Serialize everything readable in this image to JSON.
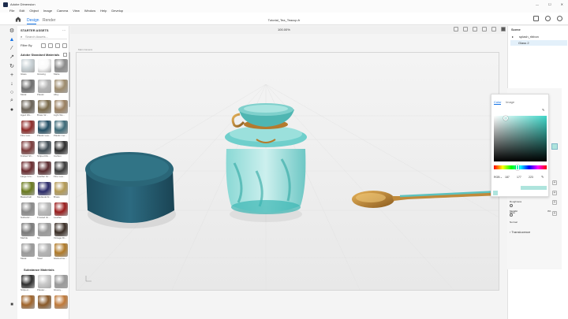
{
  "app": {
    "title": "Adobe Dimension",
    "file_title": "Tutorial_Tea_Teacup-fr"
  },
  "menu": [
    "File",
    "Edit",
    "Object",
    "Image",
    "Camera",
    "View",
    "Window",
    "Help",
    "Develop"
  ],
  "tabs": {
    "design": "Design",
    "render": "Render"
  },
  "assets": {
    "header": "STARTER ASSETS",
    "search_placeholder": "Search Assets...",
    "filter_label": "Filter By",
    "standard_header": "Adobe Standard Materials",
    "substance_header": "Substance Materials",
    "standard": [
      {
        "label": "Glass",
        "color": "#c9d2d6"
      },
      {
        "label": "Glowing",
        "color": "#fafafa"
      },
      {
        "label": "Matte",
        "color": "#8c8c8c"
      },
      {
        "label": "Metal",
        "color": "#6e6e6e"
      },
      {
        "label": "Plastic",
        "color": "#b4b4b4"
      },
      {
        "label": "Alloy",
        "color": "#9e8c6e"
      },
      {
        "label": "Aged Wo...",
        "color": "#6a6256"
      },
      {
        "label": "Brass W...",
        "color": "#7a6a4a"
      },
      {
        "label": "Light Wo...",
        "color": "#9a8060"
      },
      {
        "label": "Fine Lea...",
        "color": "#8e2a28"
      },
      {
        "label": "Plastic Lea...",
        "color": "#214e64"
      },
      {
        "label": "Plastic Cer...",
        "color": "#3c6a78"
      },
      {
        "label": "Knitted Sh...",
        "color": "#7a3a3a"
      },
      {
        "label": "Striped Ru...",
        "color": "#3e4a52"
      },
      {
        "label": "Carbon",
        "color": "#2c2c2c"
      },
      {
        "label": "Large Gro...",
        "color": "#6a2a2e"
      },
      {
        "label": "Leather Gr...",
        "color": "#5a2a2e"
      },
      {
        "label": "Fine Lea...",
        "color": "#3a3a3a"
      },
      {
        "label": "Basketball",
        "color": "#6a7a1e"
      },
      {
        "label": "Medieval Al...",
        "color": "#2a2a6a"
      },
      {
        "label": "Brass",
        "color": "#b49a54"
      },
      {
        "label": "Galvaniz...",
        "color": "#8a8a8a"
      },
      {
        "label": "Frosted Gl...",
        "color": "#b8b8b8"
      },
      {
        "label": "Leather",
        "color": "#9a1c1c"
      },
      {
        "label": "Marble",
        "color": "#7a7a7a"
      },
      {
        "label": "Sit",
        "color": "#9a9a9a"
      },
      {
        "label": "Vintage Di...",
        "color": "#3a2e26"
      },
      {
        "label": "Metal",
        "color": "#9a9a9a"
      },
      {
        "label": "Steel",
        "color": "#b4b4b4"
      },
      {
        "label": "Glazed Ce...",
        "color": "#b07a28"
      }
    ],
    "substance": [
      {
        "label": "Striped...",
        "color": "#2e2e2e"
      },
      {
        "label": "Plaster...",
        "color": "#c8c8c8"
      },
      {
        "label": "Glossy...",
        "color": "#9a9a9a"
      },
      {
        "label": "",
        "color": "#a0642a"
      },
      {
        "label": "",
        "color": "#8a5a2a"
      },
      {
        "label": "",
        "color": "#c07a3a"
      }
    ]
  },
  "viewport": {
    "zoom": "100.00%",
    "label": "Main Camera"
  },
  "scene": {
    "header": "Scene",
    "rows": [
      "splash_ribbon",
      "Glass 2"
    ]
  },
  "color_picker": {
    "tabs": [
      "Color",
      "Image"
    ],
    "mode": "RGB",
    "r": "187",
    "g": "177",
    "b": "223",
    "hex_label": "Hex"
  },
  "properties": {
    "rows": [
      "Roughness",
      "Metallic",
      "Glow",
      "Normal"
    ],
    "glow_value": "0%",
    "translucence": "Translucence"
  }
}
